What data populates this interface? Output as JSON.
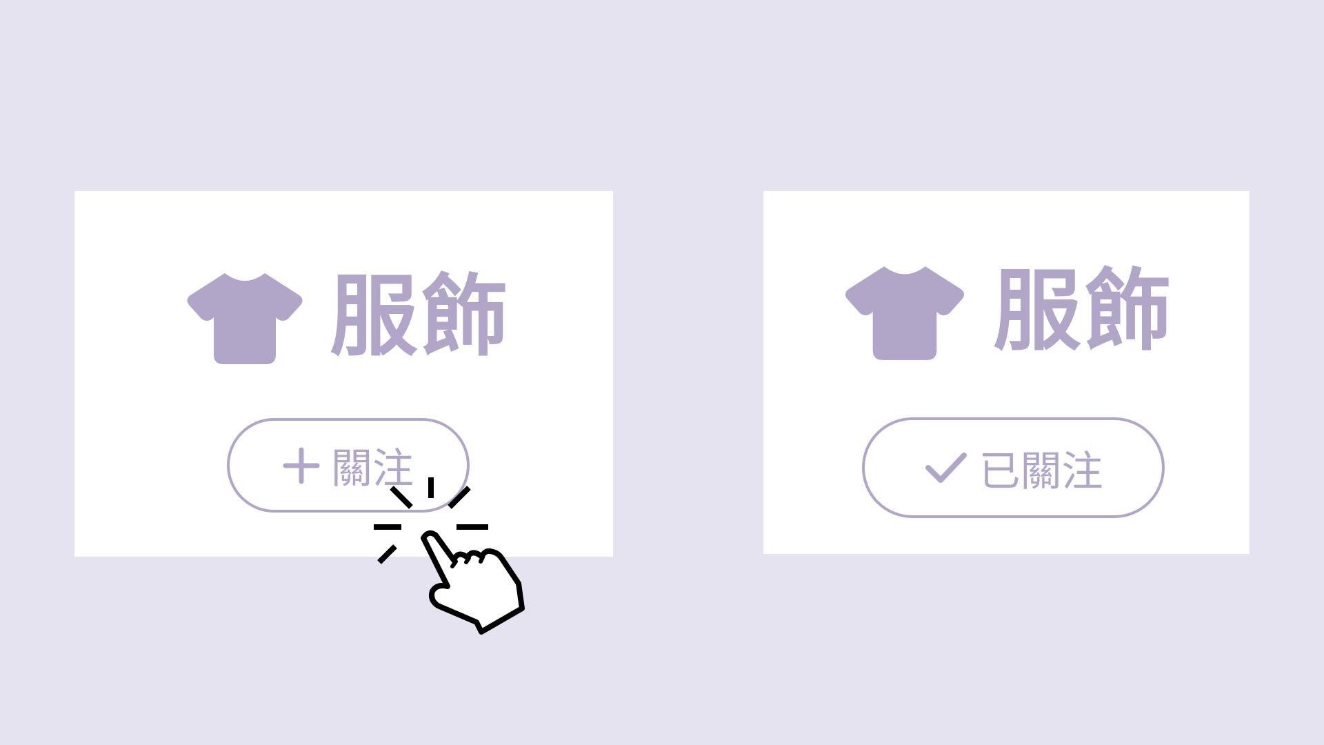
{
  "colors": {
    "background": "#e5e3ef",
    "card": "#ffffff",
    "accent": "#b1a6c8",
    "cursor": "#000000"
  },
  "cards": [
    {
      "category": {
        "icon": "tshirt-icon",
        "label": "服飾"
      },
      "button": {
        "icon": "plus-icon",
        "label": "關注",
        "state": "not-followed"
      }
    },
    {
      "category": {
        "icon": "tshirt-icon",
        "label": "服飾"
      },
      "button": {
        "icon": "check-icon",
        "label": "已關注",
        "state": "followed"
      }
    }
  ],
  "cursor": {
    "icon": "pointer-hand-click-icon"
  }
}
